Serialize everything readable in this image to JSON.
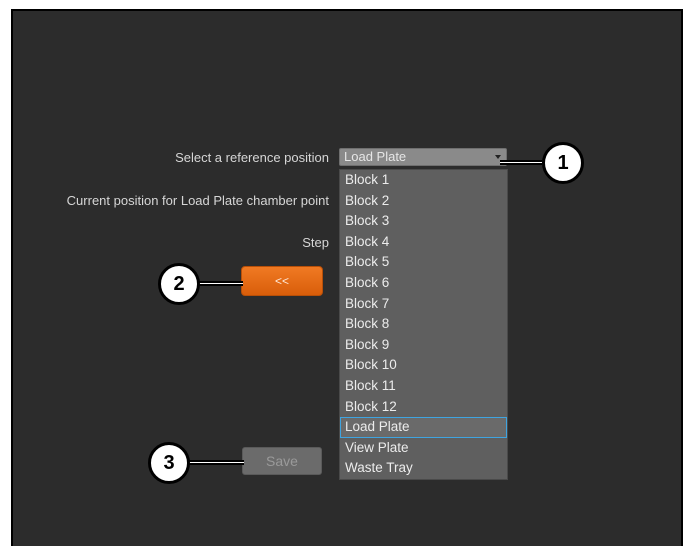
{
  "form": {
    "reference_label": "Select a reference position",
    "current_position_label": "Current position for Load Plate chamber point",
    "step_label": "Step",
    "selected_value": "Load Plate",
    "back_button_label": "<<",
    "save_button_label": "Save"
  },
  "dropdown": {
    "options": [
      "Block 1",
      "Block 2",
      "Block 3",
      "Block 4",
      "Block 5",
      "Block 6",
      "Block 7",
      "Block 8",
      "Block 9",
      "Block 10",
      "Block 11",
      "Block 12",
      "Load Plate",
      "View Plate",
      "Waste Tray"
    ],
    "highlighted_option": "Load Plate"
  },
  "callouts": [
    "1",
    "2",
    "3"
  ],
  "colors": {
    "background": "#2c2c2c",
    "accent_orange": "#e96a15",
    "highlight_border": "#3fa4e0"
  }
}
